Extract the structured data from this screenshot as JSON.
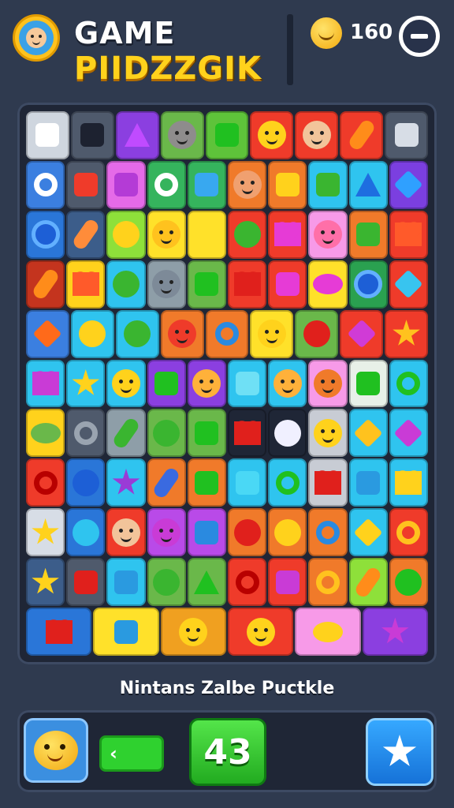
{
  "header": {
    "title_line1": "GAME",
    "title_line2": "PIIDZZGIK",
    "score": "160",
    "logo_icon": "mascot-face-icon",
    "coin_icon": "smiley-coin-icon",
    "minus_icon": "minus-icon"
  },
  "board": {
    "rows": [
      [
        {
          "c": "#cfd6df",
          "s": "square",
          "g": "#ffffff"
        },
        {
          "c": "#4f5a6c",
          "s": "square",
          "g": "#1d2230"
        },
        {
          "c": "#8b3fe0",
          "s": "tri",
          "g": "#c04bff"
        },
        {
          "c": "#6ab84a",
          "s": "face",
          "g": "#8e8c8c"
        },
        {
          "c": "#5ec33a",
          "s": "square",
          "g": "#20c020"
        },
        {
          "c": "#ef3b2a",
          "s": "face",
          "g": "#ffd21c"
        },
        {
          "c": "#ef3b2a",
          "s": "face",
          "g": "#f2c49a"
        },
        {
          "c": "#ef3b2a",
          "s": "pill",
          "g": "#ff8c1a"
        },
        {
          "c": "#4f5a6c",
          "s": "square",
          "g": "#d7dde6"
        }
      ],
      [
        {
          "c": "#3b7fe0",
          "s": "ring",
          "g": "#ffffff"
        },
        {
          "c": "#4f5a6c",
          "s": "square",
          "g": "#ef3b2a"
        },
        {
          "c": "#e56ae8",
          "s": "square",
          "g": "#b43bd6"
        },
        {
          "c": "#35b45d",
          "s": "ring",
          "g": "#ffffff"
        },
        {
          "c": "#35b45d",
          "s": "square",
          "g": "#38a8f0"
        },
        {
          "c": "#f07a2a",
          "s": "face",
          "g": "#f0a070"
        },
        {
          "c": "#f07a2a",
          "s": "square",
          "g": "#ffd21c"
        },
        {
          "c": "#2fc4ef",
          "s": "square",
          "g": "#3ab530"
        },
        {
          "c": "#2fc4ef",
          "s": "tri",
          "g": "#1e6ee0"
        },
        {
          "c": "#7b3fe0",
          "s": "diamond",
          "g": "#2fa0ff"
        }
      ],
      [
        {
          "c": "#2a76d8",
          "s": "gshape",
          "g": "#1d5fd6"
        },
        {
          "c": "#3c5d8a",
          "s": "pill",
          "g": "#ff8c3a"
        },
        {
          "c": "#8ee03a",
          "s": "circle",
          "g": "#ffd21c"
        },
        {
          "c": "#ffe12a",
          "s": "face",
          "g": "#ffc21e"
        },
        {
          "c": "#ffe12a",
          "s": "square",
          "g": "#ffe12a"
        },
        {
          "c": "#ef3b2a",
          "s": "circle",
          "g": "#3ab530"
        },
        {
          "c": "#ef3b2a",
          "s": "heart",
          "g": "#e63bd6"
        },
        {
          "c": "#f79ae8",
          "s": "face",
          "g": "#ff6fa8"
        },
        {
          "c": "#f07a2a",
          "s": "square",
          "g": "#3ab530"
        },
        {
          "c": "#ef3b2a",
          "s": "heart",
          "g": "#ff5a2a"
        }
      ],
      [
        {
          "c": "#c4341e",
          "s": "pill",
          "g": "#ff8c1a"
        },
        {
          "c": "#ffd21c",
          "s": "heart",
          "g": "#ff5a2a"
        },
        {
          "c": "#2fc4ef",
          "s": "circle",
          "g": "#3ab530"
        },
        {
          "c": "#8e9ea8",
          "s": "face",
          "g": "#7d8a98"
        },
        {
          "c": "#6ab84a",
          "s": "square",
          "g": "#20c020"
        },
        {
          "c": "#ef3b2a",
          "s": "heart",
          "g": "#e0201c"
        },
        {
          "c": "#ef3b2a",
          "s": "square",
          "g": "#e63bd6"
        },
        {
          "c": "#ffe12a",
          "s": "oval",
          "g": "#e63bd6"
        },
        {
          "c": "#2aa150",
          "s": "gshape",
          "g": "#1d5fd6"
        },
        {
          "c": "#ef3b2a",
          "s": "diamond",
          "g": "#38c4ef"
        }
      ],
      [
        {
          "c": "#3b7fe0",
          "s": "diamond",
          "g": "#ff6a1a"
        },
        {
          "c": "#2fc4ef",
          "s": "circle",
          "g": "#ffd21c"
        },
        {
          "c": "#2fc4ef",
          "s": "circle",
          "g": "#3ab530"
        },
        {
          "c": "#f07a2a",
          "s": "face",
          "g": "#ef3b2a"
        },
        {
          "c": "#f07a2a",
          "s": "ring",
          "g": "#2a8ae0"
        },
        {
          "c": "#ffe12a",
          "s": "face",
          "g": "#ffd21c"
        },
        {
          "c": "#6ab84a",
          "s": "circle",
          "g": "#e0201c"
        },
        {
          "c": "#ef3b2a",
          "s": "diamond",
          "g": "#d03bd6"
        },
        {
          "c": "#ef3b2a",
          "s": "star",
          "g": "#ffc21e"
        }
      ],
      [
        {
          "c": "#2fc4ef",
          "s": "heart",
          "g": "#c93bd6"
        },
        {
          "c": "#2fc4ef",
          "s": "star",
          "g": "#ffd21c"
        },
        {
          "c": "#2fc4ef",
          "s": "face",
          "g": "#ffd21c"
        },
        {
          "c": "#8b3fe0",
          "s": "square",
          "g": "#20c020"
        },
        {
          "c": "#8b3fe0",
          "s": "face",
          "g": "#ffb13a"
        },
        {
          "c": "#2fc4ef",
          "s": "square",
          "g": "#6fe0f5"
        },
        {
          "c": "#2fc4ef",
          "s": "face",
          "g": "#ffb13a"
        },
        {
          "c": "#f79ae8",
          "s": "face",
          "g": "#f07a2a"
        },
        {
          "c": "#e8f0e8",
          "s": "square",
          "g": "#20c020"
        },
        {
          "c": "#2fc4ef",
          "s": "ring",
          "g": "#20c020"
        }
      ],
      [
        {
          "c": "#ffd21c",
          "s": "oval",
          "g": "#6ab84a"
        },
        {
          "c": "#4f5a6c",
          "s": "ring",
          "g": "#9aa4b0"
        },
        {
          "c": "#8e9ea8",
          "s": "pill",
          "g": "#3ab530"
        },
        {
          "c": "#6ab84a",
          "s": "circle",
          "g": "#3ab530"
        },
        {
          "c": "#6ab84a",
          "s": "square",
          "g": "#20c020"
        },
        {
          "c": "#1f2636",
          "s": "heart",
          "g": "#e0201c"
        },
        {
          "c": "#1f2636",
          "s": "circle",
          "g": "#f0f0ff"
        },
        {
          "c": "#c8ccd4",
          "s": "face",
          "g": "#ffd21c"
        },
        {
          "c": "#2fc4ef",
          "s": "diamond",
          "g": "#ffc21e"
        },
        {
          "c": "#2fc4ef",
          "s": "diamond",
          "g": "#c93bd6"
        }
      ],
      [
        {
          "c": "#ef3b2a",
          "s": "ring",
          "g": "#b80000"
        },
        {
          "c": "#2a76d8",
          "s": "circle",
          "g": "#1d5fd6"
        },
        {
          "c": "#2fc4ef",
          "s": "star",
          "g": "#9a3bd6"
        },
        {
          "c": "#f07a2a",
          "s": "pill",
          "g": "#3a6ae0"
        },
        {
          "c": "#f07a2a",
          "s": "square",
          "g": "#20c020"
        },
        {
          "c": "#2fc4ef",
          "s": "square",
          "g": "#4ad8f5"
        },
        {
          "c": "#2fc4ef",
          "s": "ring",
          "g": "#20c020"
        },
        {
          "c": "#c8ccd4",
          "s": "heart",
          "g": "#e0201c"
        },
        {
          "c": "#2fc4ef",
          "s": "square",
          "g": "#2a9ae0"
        },
        {
          "c": "#2fc4ef",
          "s": "heart",
          "g": "#ffd21c"
        }
      ],
      [
        {
          "c": "#d7dde6",
          "s": "star",
          "g": "#ffd21c"
        },
        {
          "c": "#2a76d8",
          "s": "circle",
          "g": "#2fc4ef"
        },
        {
          "c": "#ef3b2a",
          "s": "face",
          "g": "#f2c49a"
        },
        {
          "c": "#b94ae8",
          "s": "face",
          "g": "#c93bd6"
        },
        {
          "c": "#b94ae8",
          "s": "square",
          "g": "#2a8ae0"
        },
        {
          "c": "#f07a2a",
          "s": "circle",
          "g": "#e0201c"
        },
        {
          "c": "#f07a2a",
          "s": "circle",
          "g": "#ffd21c"
        },
        {
          "c": "#f07a2a",
          "s": "ring",
          "g": "#2a8ae0"
        },
        {
          "c": "#2fc4ef",
          "s": "diamond",
          "g": "#ffd21c"
        },
        {
          "c": "#ef3b2a",
          "s": "ring",
          "g": "#ffc21e"
        }
      ],
      [
        {
          "c": "#3c5d8a",
          "s": "star",
          "g": "#ffd21c"
        },
        {
          "c": "#4f5a6c",
          "s": "square",
          "g": "#e0201c"
        },
        {
          "c": "#2fc4ef",
          "s": "square",
          "g": "#2a9ae0"
        },
        {
          "c": "#6ab84a",
          "s": "circle",
          "g": "#3ab530"
        },
        {
          "c": "#6ab84a",
          "s": "tri",
          "g": "#20c020"
        },
        {
          "c": "#ef3b2a",
          "s": "ring",
          "g": "#b80000"
        },
        {
          "c": "#ef3b2a",
          "s": "square",
          "g": "#c93bd6"
        },
        {
          "c": "#f07a2a",
          "s": "ring",
          "g": "#ffc21e"
        },
        {
          "c": "#8ee03a",
          "s": "pill",
          "g": "#ff8c1a"
        },
        {
          "c": "#f07a2a",
          "s": "circle",
          "g": "#20c020"
        }
      ],
      [
        {
          "c": "#2a76d8",
          "s": "heart",
          "g": "#e0201c"
        },
        {
          "c": "#ffe12a",
          "s": "square",
          "g": "#2a9ae0"
        },
        {
          "c": "#f0a020",
          "s": "face",
          "g": "#ffd21c"
        },
        {
          "c": "#ef3b2a",
          "s": "face",
          "g": "#ffd21c"
        },
        {
          "c": "#f79ae8",
          "s": "oval",
          "g": "#ffd21c"
        },
        {
          "c": "#8b3fe0",
          "s": "star",
          "g": "#c93bd6"
        }
      ]
    ]
  },
  "game_label": "Nintans Zalbe Puctkle",
  "footer": {
    "back_icon": "back-arrow-icon",
    "back_label": "‹",
    "moves": "43",
    "mascot_icon": "mascot-icon",
    "star_icon": "star-icon"
  }
}
